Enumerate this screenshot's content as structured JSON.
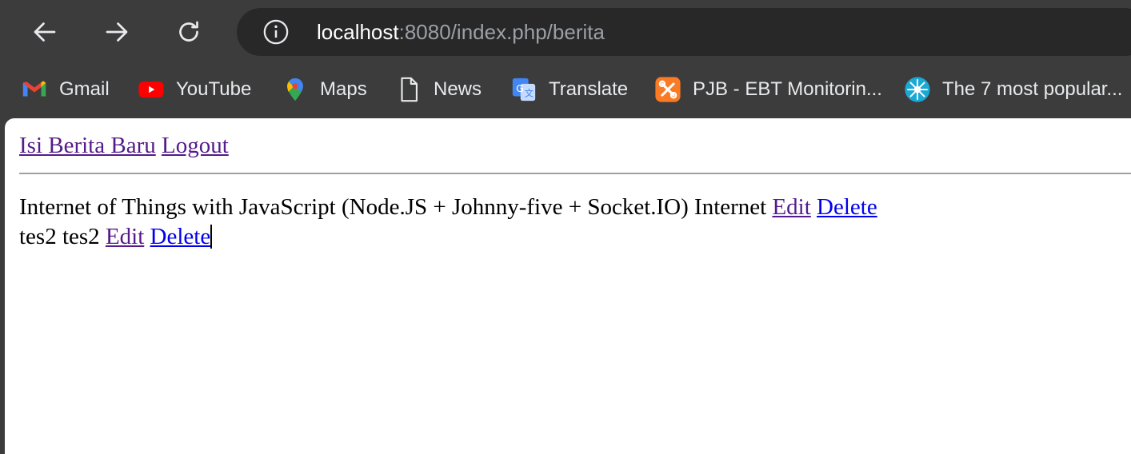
{
  "browser": {
    "url_host": "localhost",
    "url_rest": ":8080/index.php/berita",
    "bookmarks": [
      {
        "label": "Gmail",
        "icon": "gmail-icon"
      },
      {
        "label": "YouTube",
        "icon": "youtube-icon"
      },
      {
        "label": "Maps",
        "icon": "maps-icon"
      },
      {
        "label": "News",
        "icon": "document-icon"
      },
      {
        "label": "Translate",
        "icon": "translate-icon"
      },
      {
        "label": "PJB - EBT Monitorin...",
        "icon": "xampp-icon"
      },
      {
        "label": "The 7 most popular...",
        "icon": "starburst-icon"
      }
    ]
  },
  "page": {
    "nav": {
      "new_news": "Isi Berita Baru",
      "logout": "Logout"
    },
    "rows": [
      {
        "title": "Internet of Things with JavaScript (Node.JS + Johnny-five + Socket.IO)",
        "category": "Internet",
        "edit": "Edit",
        "delete": "Delete"
      },
      {
        "title": "tes2",
        "category": "tes2",
        "edit": "Edit",
        "delete": "Delete"
      }
    ]
  },
  "colors": {
    "link_visited": "#551a8b",
    "link_unvisited": "#0000ee",
    "chrome_bg": "#3c3c3c",
    "omnibox_bg": "#282828"
  }
}
